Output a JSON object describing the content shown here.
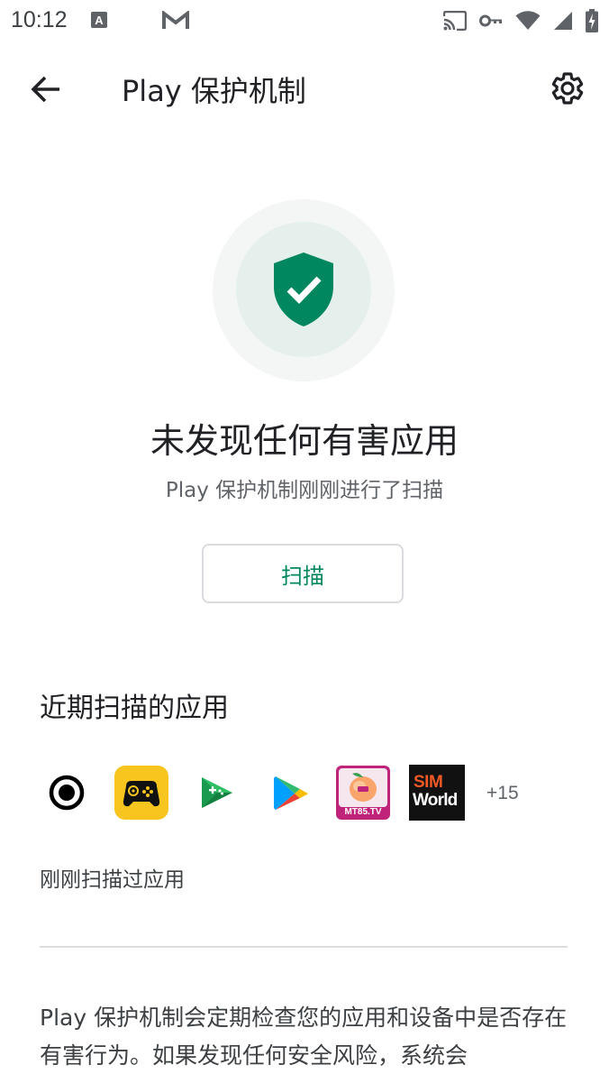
{
  "status_bar": {
    "time": "10:12",
    "left_icons": [
      "a-notification-icon",
      "gmail-icon"
    ],
    "right_icons": [
      "cast-icon",
      "vpn-key-icon",
      "wifi-icon",
      "signal-icon",
      "battery-charging-icon"
    ]
  },
  "app_bar": {
    "title": "Play 保护机制"
  },
  "hero": {
    "headline": "未发现任何有害应用",
    "subline": "Play 保护机制刚刚进行了扫描",
    "scan_button_label": "扫描"
  },
  "recent": {
    "section_title": "近期扫描的应用",
    "apps": [
      {
        "name": "screen-recorder-app-icon"
      },
      {
        "name": "game-controller-app-icon"
      },
      {
        "name": "play-games-app-icon"
      },
      {
        "name": "play-store-app-icon"
      },
      {
        "name": "mt85-tv-app-icon",
        "label": "MT85.TV"
      },
      {
        "name": "sim-world-app-icon",
        "label_line1": "SIM",
        "label_line2": "World"
      }
    ],
    "more_count": "+15",
    "scan_status": "刚刚扫描过应用"
  },
  "description": {
    "text": "Play 保护机制会定期检查您的应用和设备中是否存在有害行为。如果发现任何安全风险，系统会"
  },
  "colors": {
    "accent": "#01875f",
    "shield": "#01875f",
    "ring_outer": "#f3f6f5",
    "ring_inner": "#e5f0ed"
  }
}
